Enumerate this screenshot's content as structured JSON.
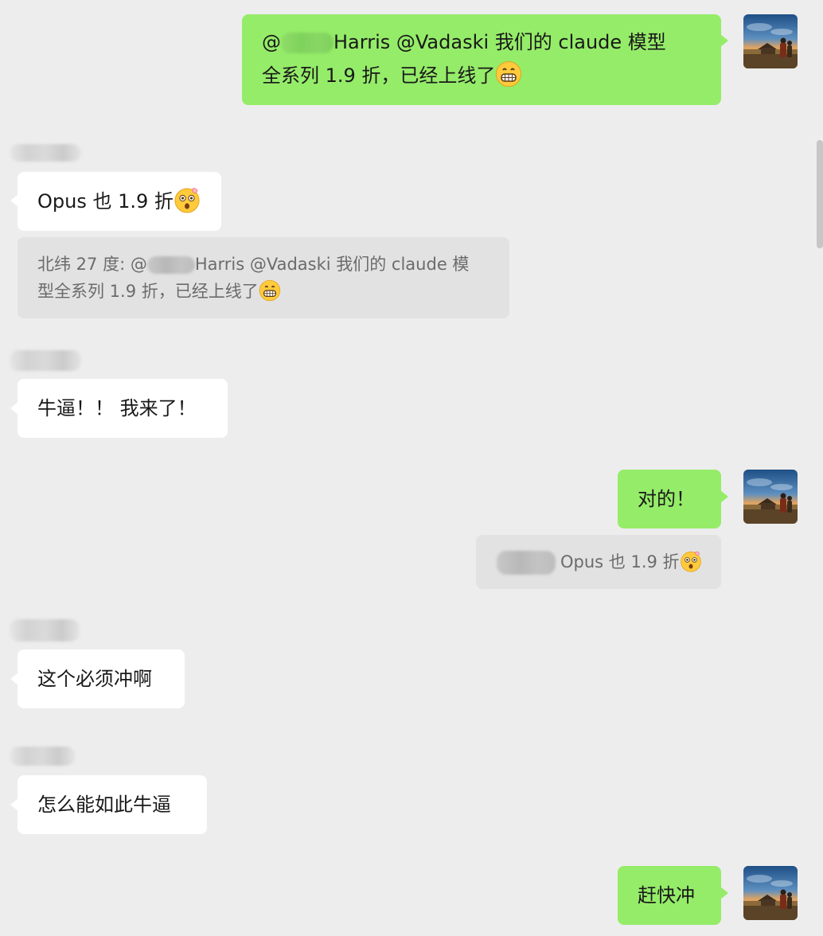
{
  "messages": [
    {
      "id": "m1",
      "direction": "outgoing",
      "mention_prefix": "@",
      "line1_rest": "Harris  @Vadaski 我们的 claude 模型",
      "line2": "全系列 1.9 折，已经上线了",
      "emoji": "grinning-face-emoji"
    },
    {
      "id": "m2",
      "direction": "incoming",
      "text": "Opus 也 1.9 折",
      "emoji": "astonished-face-emoji",
      "quote": {
        "sender": "北纬 27 度: @",
        "line1_rest": "Harris  @Vadaski 我们的 claude 模",
        "line2": "型全系列 1.9 折，已经上线了",
        "emoji": "grinning-face-emoji"
      }
    },
    {
      "id": "m3",
      "direction": "incoming",
      "text": "牛逼！！ 我来了！"
    },
    {
      "id": "m4",
      "direction": "outgoing",
      "text": "对的！",
      "quote": {
        "text": "Opus 也 1.9 折",
        "emoji": "astonished-face-emoji"
      }
    },
    {
      "id": "m5",
      "direction": "incoming",
      "text": "这个必须冲啊"
    },
    {
      "id": "m6",
      "direction": "incoming",
      "text": "怎么能如此牛逼"
    },
    {
      "id": "m7",
      "direction": "outgoing",
      "text": "赶快冲"
    }
  ],
  "colors": {
    "background": "#ededed",
    "outgoing_bubble": "#95ec69",
    "incoming_bubble": "#ffffff",
    "quote_background": "#e2e2e2"
  },
  "icons": {
    "avatar": "user-avatar-landscape",
    "grin": "grinning-face-emoji",
    "astonished": "astonished-face-emoji"
  }
}
